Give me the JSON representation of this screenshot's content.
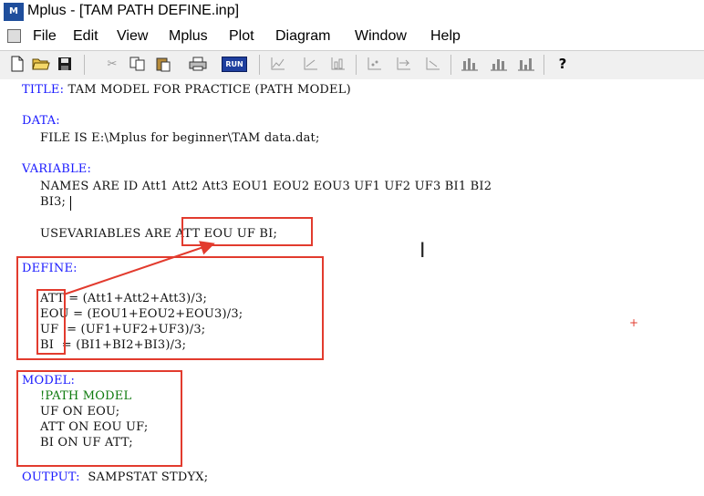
{
  "window": {
    "app_icon": "M",
    "title": "Mplus - [TAM PATH DEFINE.inp]"
  },
  "menu": [
    "File",
    "Edit",
    "View",
    "Mplus",
    "Plot",
    "Diagram",
    "Window",
    "Help"
  ],
  "toolbar": {
    "icons": [
      "new-file-icon",
      "open-folder-icon",
      "save-icon",
      "cut-icon",
      "copy-icon",
      "paste-icon",
      "print-icon",
      "run-icon",
      "plot-line-icon",
      "plot-scatter-icon",
      "plot-hist-icon",
      "plot-points-icon",
      "plot-arrow-icon",
      "plot-arrow2-icon",
      "bar-chart-icon",
      "bar-chart2-icon",
      "bar-chart3-icon",
      "help-icon"
    ],
    "run_label": "RUN",
    "help_label": "?"
  },
  "editor": {
    "title_kw": "TITLE:",
    "title_val": "TAM MODEL FOR PRACTICE (PATH MODEL)",
    "data_kw": "DATA:",
    "data_line": "FILE IS E:\\Mplus for beginner\\TAM data.dat;",
    "variable_kw": "VARIABLE:",
    "names_line": "NAMES ARE ID Att1 Att2 Att3 EOU1 EOU2 EOU3 UF1 UF2 UF3 BI1 BI2",
    "names_line2": "BI3;",
    "usevar_prefix": "USEVARIABLES ARE",
    "usevar_list": "ATT EOU UF BI",
    "usevar_semicolon": ";",
    "define_kw": "DEFINE:",
    "define_lines": [
      {
        "var": "ATT",
        "expr": "= (Att1+Att2+Att3)/3;"
      },
      {
        "var": "EOU",
        "expr": "= (EOU1+EOU2+EOU3)/3;"
      },
      {
        "var": "UF",
        "expr": "= (UF1+UF2+UF3)/3;"
      },
      {
        "var": "BI",
        "expr": "= (BI1+BI2+BI3)/3;"
      }
    ],
    "model_kw": "MODEL:",
    "model_comment": "!PATH MODEL",
    "model_lines": [
      "UF ON EOU;",
      "ATT ON EOU UF;",
      "BI ON UF ATT;"
    ],
    "output_kw": "OUTPUT:",
    "output_val": "SAMPSTAT STDYX;"
  },
  "colors": {
    "keyword": "#1a1aff",
    "comment": "#0d7a0d",
    "annotation": "#e23b2e"
  }
}
